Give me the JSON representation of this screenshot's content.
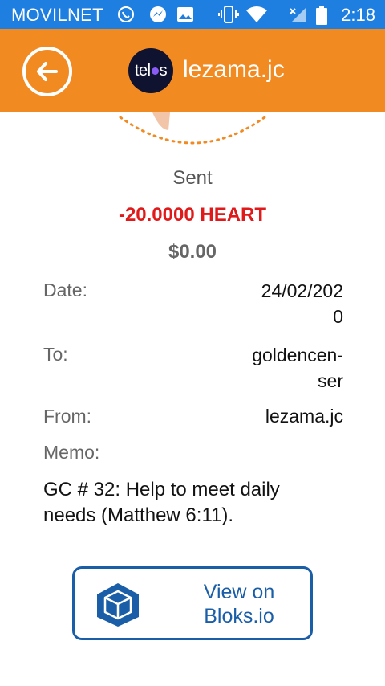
{
  "status_bar": {
    "carrier": "MOVILNET",
    "time": "2:18",
    "icons": [
      "whatsapp-icon",
      "messenger-icon",
      "gallery-icon",
      "vibrate-icon",
      "wifi-icon",
      "signal-icon",
      "battery-icon"
    ]
  },
  "header": {
    "logo_text": "tel",
    "logo_text_end": "s",
    "account_name": "lezama.jc",
    "back_icon": "back-arrow-icon",
    "colors": {
      "header_bg": "#f28a22",
      "status_bg": "#1e7fe0"
    }
  },
  "transaction": {
    "direction": "Sent",
    "amount": "-20.0000 HEART",
    "fiat_value": "$0.00",
    "date_label": "Date:",
    "date_value_line1": "24/02/202",
    "date_value_line2": "0",
    "to_label": "To:",
    "to_value_line1": "goldencen-",
    "to_value_line2": "ser",
    "from_label": "From:",
    "from_value": "lezama.jc",
    "memo_label": "Memo:",
    "memo_line1": "GC # 32: Help to meet daily",
    "memo_line2": "needs (Matthew 6:11).",
    "amount_color": "#e01a1a"
  },
  "actions": {
    "bloks_line1": "View on",
    "bloks_line2": "Bloks.io",
    "bloks_icon": "bloks-cube-icon",
    "bloks_color": "#1a5ea8"
  }
}
